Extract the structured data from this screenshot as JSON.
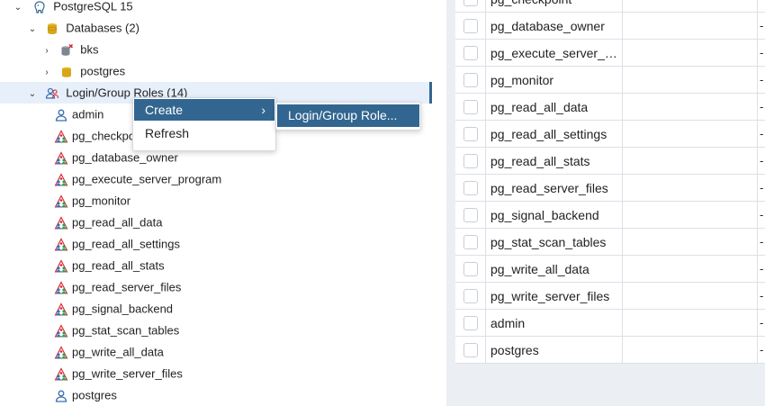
{
  "tree": {
    "server_label": "PostgreSQL 15",
    "databases_label": "Databases (2)",
    "db_bks": "bks",
    "db_postgres": "postgres",
    "roles_label": "Login/Group Roles (14)",
    "roles": [
      {
        "label": "admin",
        "icon": "user-icon"
      },
      {
        "label": "pg_checkpoint",
        "icon": "group-role-icon"
      },
      {
        "label": "pg_database_owner",
        "icon": "group-role-icon"
      },
      {
        "label": "pg_execute_server_program",
        "icon": "group-role-icon"
      },
      {
        "label": "pg_monitor",
        "icon": "group-role-icon"
      },
      {
        "label": "pg_read_all_data",
        "icon": "group-role-icon"
      },
      {
        "label": "pg_read_all_settings",
        "icon": "group-role-icon"
      },
      {
        "label": "pg_read_all_stats",
        "icon": "group-role-icon"
      },
      {
        "label": "pg_read_server_files",
        "icon": "group-role-icon"
      },
      {
        "label": "pg_signal_backend",
        "icon": "group-role-icon"
      },
      {
        "label": "pg_stat_scan_tables",
        "icon": "group-role-icon"
      },
      {
        "label": "pg_write_all_data",
        "icon": "group-role-icon"
      },
      {
        "label": "pg_write_server_files",
        "icon": "group-role-icon"
      },
      {
        "label": "postgres",
        "icon": "user-icon"
      }
    ]
  },
  "context_menu": {
    "create": "Create",
    "refresh": "Refresh",
    "submenu_item": "Login/Group Role..."
  },
  "grid": {
    "rows": [
      {
        "name": "pg_checkpoint",
        "extra": "-"
      },
      {
        "name": "pg_database_owner",
        "extra": "-"
      },
      {
        "name": "pg_execute_server_program",
        "extra": "-"
      },
      {
        "name": "pg_monitor",
        "extra": "-"
      },
      {
        "name": "pg_read_all_data",
        "extra": "-"
      },
      {
        "name": "pg_read_all_settings",
        "extra": "-"
      },
      {
        "name": "pg_read_all_stats",
        "extra": "-"
      },
      {
        "name": "pg_read_server_files",
        "extra": "-"
      },
      {
        "name": "pg_signal_backend",
        "extra": "-"
      },
      {
        "name": "pg_stat_scan_tables",
        "extra": "-"
      },
      {
        "name": "pg_write_all_data",
        "extra": "-"
      },
      {
        "name": "pg_write_server_files",
        "extra": "-"
      },
      {
        "name": "admin",
        "extra": "-"
      },
      {
        "name": "postgres",
        "extra": "-"
      }
    ]
  },
  "colors": {
    "accent": "#326690",
    "selection_bg": "#e6effa",
    "panel_bg": "#ebeef3"
  }
}
